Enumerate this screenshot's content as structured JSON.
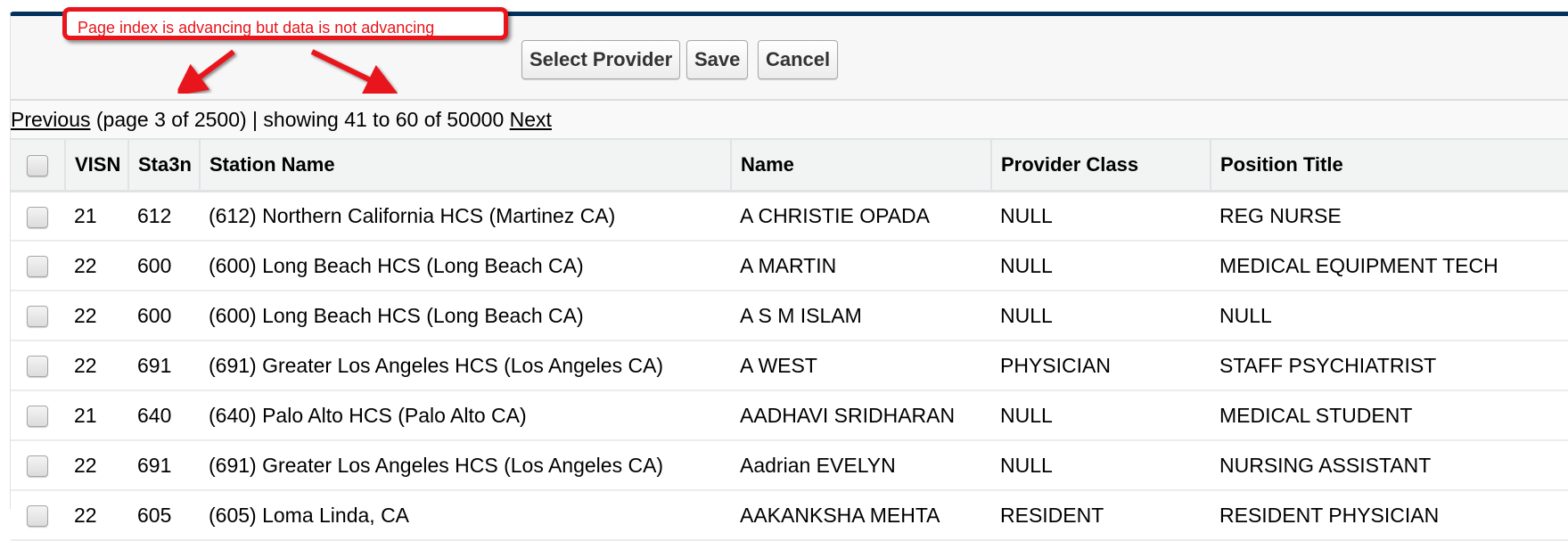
{
  "annotation": {
    "text": "Page index is advancing but data is not advancing",
    "color": "#e8151b"
  },
  "toolbar": {
    "select_provider_label": "Select Provider",
    "save_label": "Save",
    "cancel_label": "Cancel"
  },
  "pager": {
    "previous_label": "Previous",
    "status_text": " (page 3 of 2500) | showing 41 to 60 of 50000 ",
    "next_label": "Next",
    "current_page": 3,
    "total_pages": 2500,
    "range_start": 41,
    "range_end": 60,
    "total_records": 50000
  },
  "table": {
    "columns": [
      "VISN",
      "Sta3n",
      "Station Name",
      "Name",
      "Provider Class",
      "Position Title"
    ],
    "rows": [
      {
        "visn": "21",
        "sta3n": "612",
        "station_name": "(612) Northern California HCS (Martinez CA)",
        "name": "A CHRISTIE OPADA",
        "provider_class": "NULL",
        "position_title": "REG NURSE",
        "checked": false
      },
      {
        "visn": "22",
        "sta3n": "600",
        "station_name": "(600) Long Beach HCS (Long Beach CA)",
        "name": "A MARTIN",
        "provider_class": "NULL",
        "position_title": "MEDICAL EQUIPMENT TECH",
        "checked": false
      },
      {
        "visn": "22",
        "sta3n": "600",
        "station_name": "(600) Long Beach HCS (Long Beach CA)",
        "name": "A S M ISLAM",
        "provider_class": "NULL",
        "position_title": "NULL",
        "checked": false
      },
      {
        "visn": "22",
        "sta3n": "691",
        "station_name": "(691) Greater Los Angeles HCS (Los Angeles CA)",
        "name": "A WEST",
        "provider_class": "PHYSICIAN",
        "position_title": "STAFF PSYCHIATRIST",
        "checked": false
      },
      {
        "visn": "21",
        "sta3n": "640",
        "station_name": "(640) Palo Alto HCS (Palo Alto CA)",
        "name": "AADHAVI SRIDHARAN",
        "provider_class": "NULL",
        "position_title": "MEDICAL STUDENT",
        "checked": false
      },
      {
        "visn": "22",
        "sta3n": "691",
        "station_name": "(691) Greater Los Angeles HCS (Los Angeles CA)",
        "name": "Aadrian EVELYN",
        "provider_class": "NULL",
        "position_title": "NURSING ASSISTANT",
        "checked": false
      },
      {
        "visn": "22",
        "sta3n": "605",
        "station_name": "(605) Loma Linda, CA",
        "name": "AAKANKSHA MEHTA",
        "provider_class": "RESIDENT",
        "position_title": "RESIDENT PHYSICIAN",
        "checked": false
      }
    ]
  }
}
